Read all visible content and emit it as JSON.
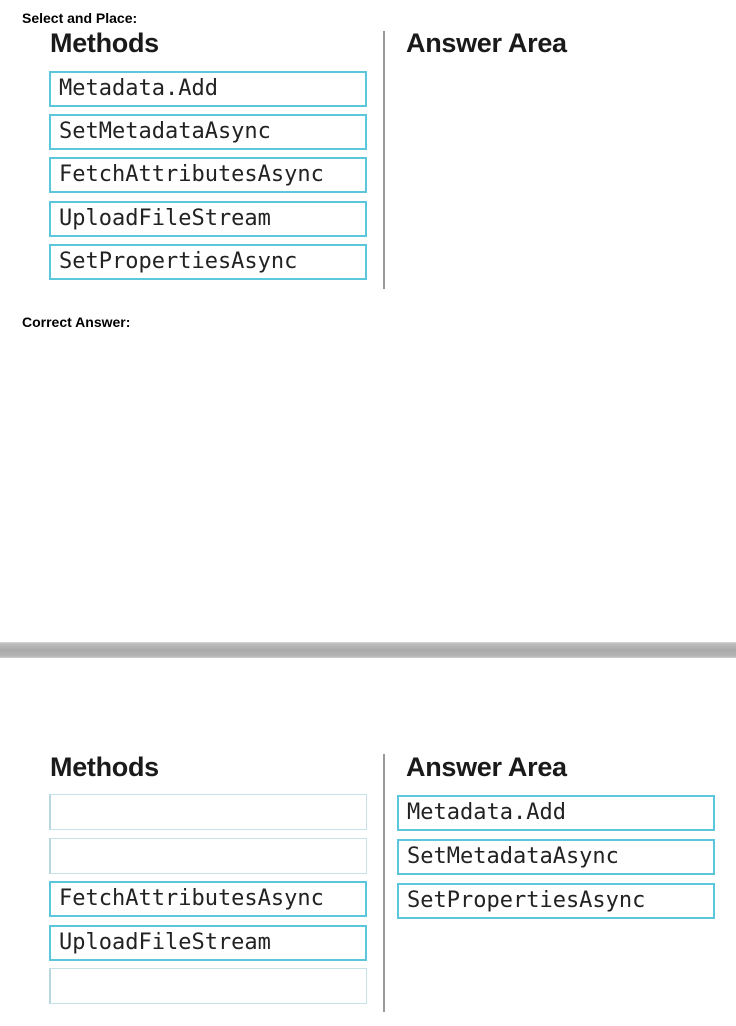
{
  "question": {
    "instruction_label": "Select and Place:",
    "methods_heading": "Methods",
    "answer_heading": "Answer Area",
    "methods": [
      "Metadata.Add",
      "SetMetadataAsync",
      "FetchAttributesAsync",
      "UploadFileStream",
      "SetPropertiesAsync"
    ]
  },
  "answer": {
    "label": "Correct Answer:",
    "methods_heading": "Methods",
    "answer_heading": "Answer Area",
    "remaining_methods": [
      "",
      "",
      "FetchAttributesAsync",
      "UploadFileStream",
      ""
    ],
    "placed_answers": [
      "Metadata.Add",
      "SetMetadataAsync",
      "SetPropertiesAsync"
    ]
  },
  "colors": {
    "slot_border": "#5bc6dc",
    "divider": "#9a9a9a"
  }
}
